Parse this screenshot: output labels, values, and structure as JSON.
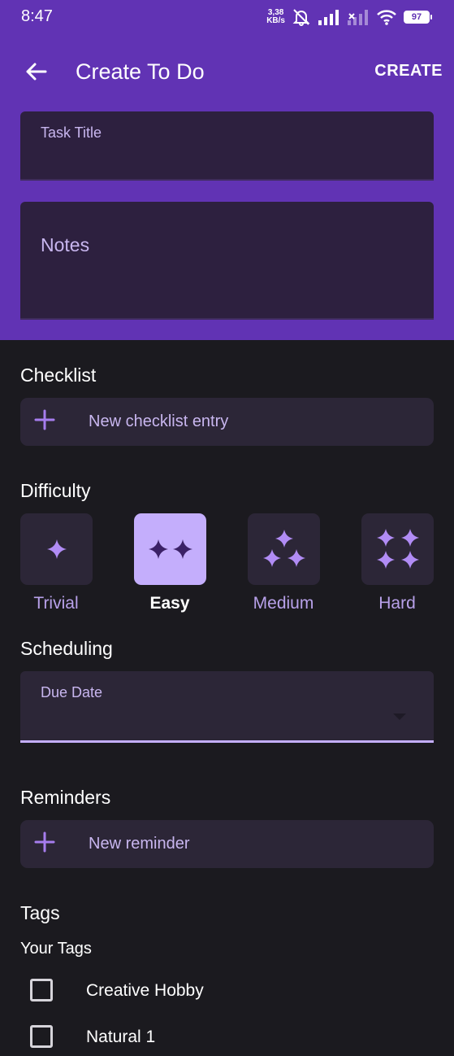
{
  "status_bar": {
    "time": "8:47",
    "net_speed_value": "3,38",
    "net_speed_unit": "KB/s",
    "battery": "97"
  },
  "toolbar": {
    "title": "Create To Do",
    "create_label": "CREATE",
    "back_icon": "arrow-left-icon"
  },
  "form": {
    "task_title_label": "Task Title",
    "notes_placeholder": "Notes"
  },
  "checklist": {
    "title": "Checklist",
    "add_label": "New checklist entry"
  },
  "difficulty": {
    "title": "Difficulty",
    "options": [
      {
        "label": "Trivial",
        "selected": false
      },
      {
        "label": "Easy",
        "selected": true
      },
      {
        "label": "Medium",
        "selected": false
      },
      {
        "label": "Hard",
        "selected": false
      }
    ]
  },
  "scheduling": {
    "title": "Scheduling",
    "due_date_label": "Due Date"
  },
  "reminders": {
    "title": "Reminders",
    "add_label": "New reminder"
  },
  "tags": {
    "title": "Tags",
    "subtitle": "Your Tags",
    "items": [
      {
        "label": "Creative Hobby",
        "checked": false
      },
      {
        "label": "Natural 1",
        "checked": false
      }
    ]
  },
  "colors": {
    "header_bg": "#6133b4",
    "field_bg": "#2d203f",
    "page_bg": "#1b1a1f",
    "card_bg": "#2c2637",
    "accent": "#c4aefc",
    "accent_text": "#b8a1ea"
  }
}
